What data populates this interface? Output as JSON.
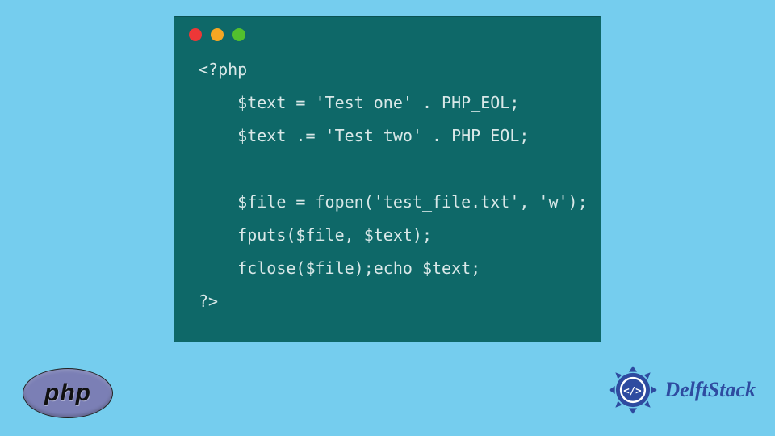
{
  "code": {
    "lines": [
      "<?php",
      "    $text = 'Test one' . PHP_EOL;",
      "    $text .= 'Test two' . PHP_EOL;",
      "",
      "    $file = fopen('test_file.txt', 'w');",
      "    fputs($file, $text);",
      "    fclose($file);echo $text;",
      "?>"
    ]
  },
  "php_badge": {
    "label": "php"
  },
  "brand": {
    "name": "DelftStack"
  },
  "colors": {
    "bg": "#75cdee",
    "window": "#0e6868",
    "code_text": "#d9e8e8",
    "brand": "#2e4ba0",
    "php_badge": "#7b7fb5"
  }
}
